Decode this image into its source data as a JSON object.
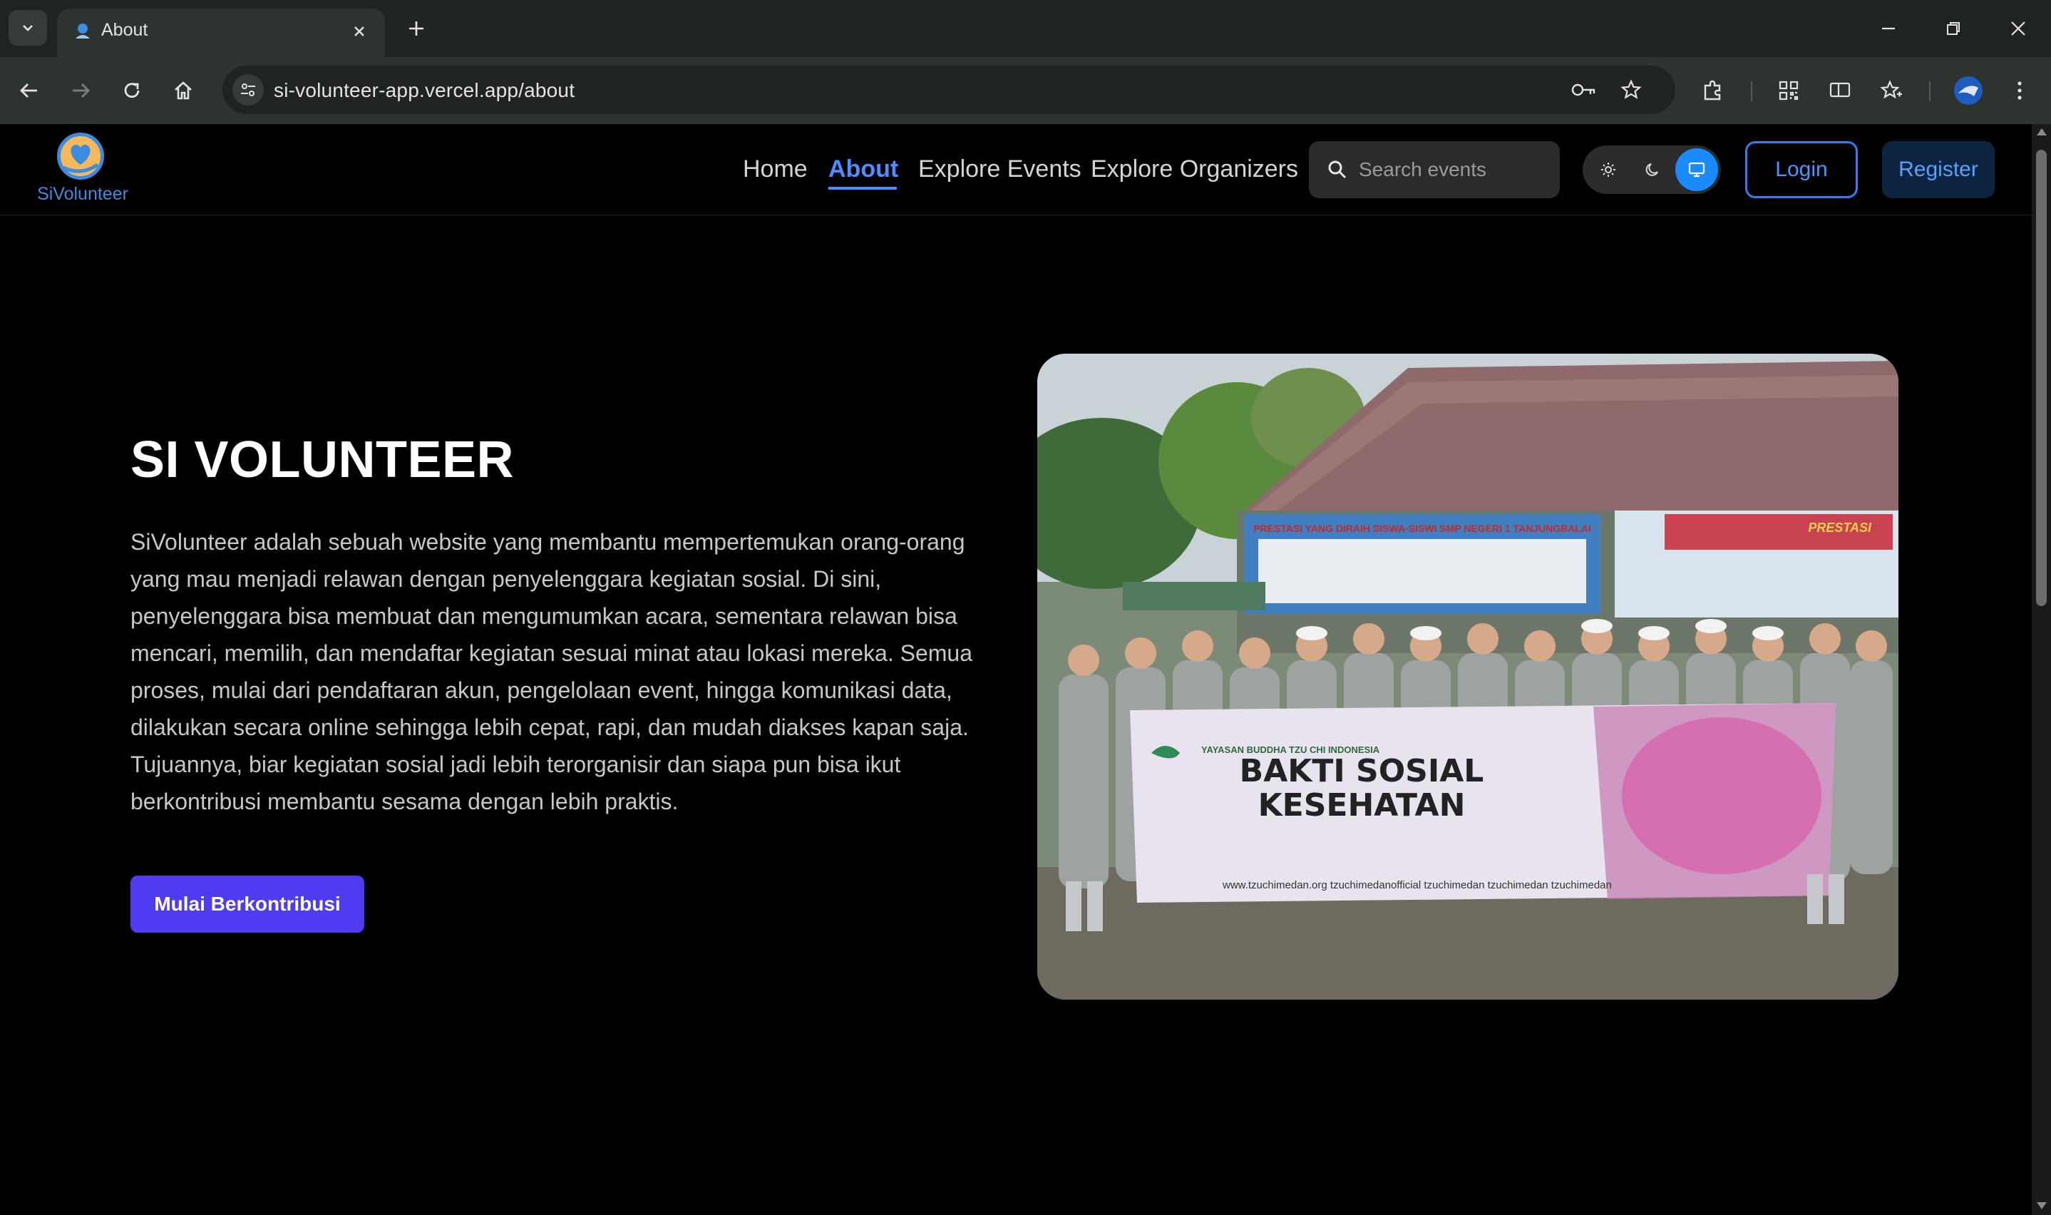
{
  "browser": {
    "tab_title": "About",
    "url": "si-volunteer-app.vercel.app/about"
  },
  "site": {
    "logo_text": "SiVolunteer",
    "nav": [
      {
        "label": "Home"
      },
      {
        "label": "About"
      },
      {
        "label": "Explore Events"
      },
      {
        "label": "Explore Organizers"
      }
    ],
    "search_placeholder": "Search events",
    "login_label": "Login",
    "register_label": "Register",
    "theme_modes": [
      "light-icon",
      "moon-icon",
      "monitor-icon"
    ],
    "theme_selected": "system"
  },
  "hero": {
    "title": "SI VOLUNTEER",
    "description": "SiVolunteer adalah sebuah website yang membantu mempertemukan orang-orang yang mau menjadi relawan dengan penyelenggara kegiatan sosial. Di sini, penyelenggara bisa membuat dan mengumumkan acara, sementara relawan bisa mencari, memilih, dan mendaftar kegiatan sesuai minat atau lokasi mereka. Semua proses, mulai dari pendaftaran akun, pengelolaan event, hingga komunikasi data, dilakukan secara online sehingga lebih cepat, rapi, dan mudah diakses kapan saja. Tujuannya, biar kegiatan sosial jadi lebih terorganisir dan siapa pun bisa ikut berkontribusi membantu sesama dengan lebih praktis.",
    "cta_label": "Mulai Berkontribusi",
    "photo": {
      "banner_title_line1": "BAKTI SOSIAL",
      "banner_title_line2": "KESEHATAN",
      "banner_org": "YAYASAN BUDDHA TZU CHI INDONESIA",
      "banner_links": "www.tzuchimedan.org   tzuchimedanofficial   tzuchimedan   tzuchimedan   tzuchimedan",
      "poster_left": "PRESTASI YANG DIRAIH SISWA-SISWI SMP NEGERI 1 TANJUNGBALAI",
      "poster_right": "PRESTASI"
    }
  },
  "colors": {
    "accent": "#4d8dff",
    "cta": "#4f3cf0",
    "background": "#000000"
  }
}
